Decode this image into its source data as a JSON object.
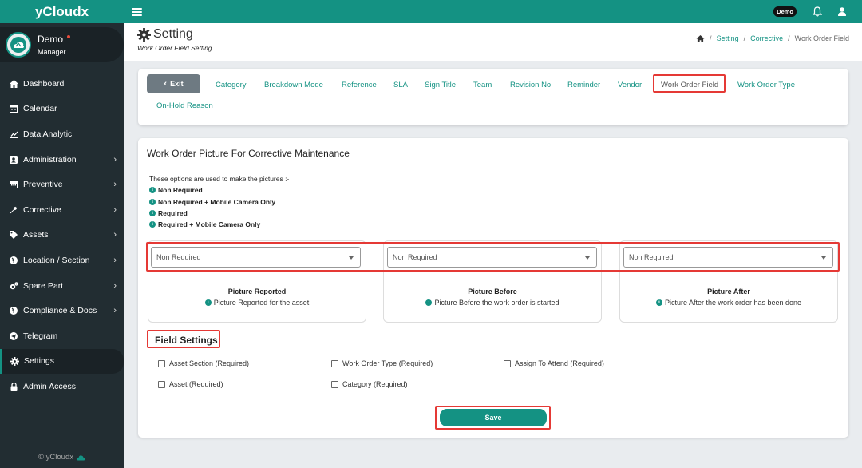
{
  "app": {
    "brand": "yCloudx",
    "footer": "© yCloudx"
  },
  "user": {
    "name": "Demo",
    "role": "Manager"
  },
  "topbar": {
    "badge": "Demo"
  },
  "menu": [
    {
      "label": "Dashboard",
      "icon": "home-icon"
    },
    {
      "label": "Calendar",
      "icon": "calendar-icon"
    },
    {
      "label": "Data Analytic",
      "icon": "chart-icon"
    },
    {
      "label": "Administration",
      "icon": "id-card-icon",
      "has_children": true
    },
    {
      "label": "Preventive",
      "icon": "calendar-icon",
      "has_children": true
    },
    {
      "label": "Corrective",
      "icon": "wrench-icon",
      "has_children": true
    },
    {
      "label": "Assets",
      "icon": "tag-icon",
      "has_children": true
    },
    {
      "label": "Location / Section",
      "icon": "globe-icon",
      "has_children": true
    },
    {
      "label": "Spare Part",
      "icon": "cogs-icon",
      "has_children": true
    },
    {
      "label": "Compliance & Docs",
      "icon": "globe-icon",
      "has_children": true
    },
    {
      "label": "Telegram",
      "icon": "telegram-icon"
    },
    {
      "label": "Settings",
      "icon": "gear-icon",
      "active": true
    },
    {
      "label": "Admin Access",
      "icon": "lock-icon"
    }
  ],
  "header": {
    "title": "Setting",
    "subtitle": "Work Order Field Setting",
    "breadcrumb": [
      "Setting",
      "Corrective",
      "Work Order Field"
    ]
  },
  "tabs": {
    "exit_label": "Exit",
    "items": [
      "Category",
      "Breakdown Mode",
      "Reference",
      "SLA",
      "Sign Title",
      "Team",
      "Revision No",
      "Reminder",
      "Vendor",
      "Work Order Field",
      "Work Order Type",
      "On-Hold Reason"
    ],
    "active": "Work Order Field"
  },
  "picture_section": {
    "title": "Work Order Picture For Corrective Maintenance",
    "intro": "These options are used to make the pictures :-",
    "options": [
      "Non Required",
      "Non Required + Mobile Camera Only",
      "Required",
      "Required + Mobile Camera Only"
    ],
    "pictures": [
      {
        "select_value": "Non Required",
        "label": "Picture Reported",
        "desc": "Picture Reported for the asset"
      },
      {
        "select_value": "Non Required",
        "label": "Picture Before",
        "desc": "Picture Before the work order is started"
      },
      {
        "select_value": "Non Required",
        "label": "Picture After",
        "desc": "Picture After the work order has been done"
      }
    ]
  },
  "field_settings": {
    "title": "Field Settings",
    "checkboxes": [
      {
        "label": "Asset Section (Required)",
        "checked": false
      },
      {
        "label": "Work Order Type (Required)",
        "checked": false
      },
      {
        "label": "Assign To Attend (Required)",
        "checked": false
      },
      {
        "label": "Asset (Required)",
        "checked": false
      },
      {
        "label": "Category (Required)",
        "checked": false
      }
    ],
    "save_label": "Save"
  },
  "colors": {
    "accent": "#149283",
    "sidebar": "#222d32",
    "highlight": "#e53935"
  }
}
